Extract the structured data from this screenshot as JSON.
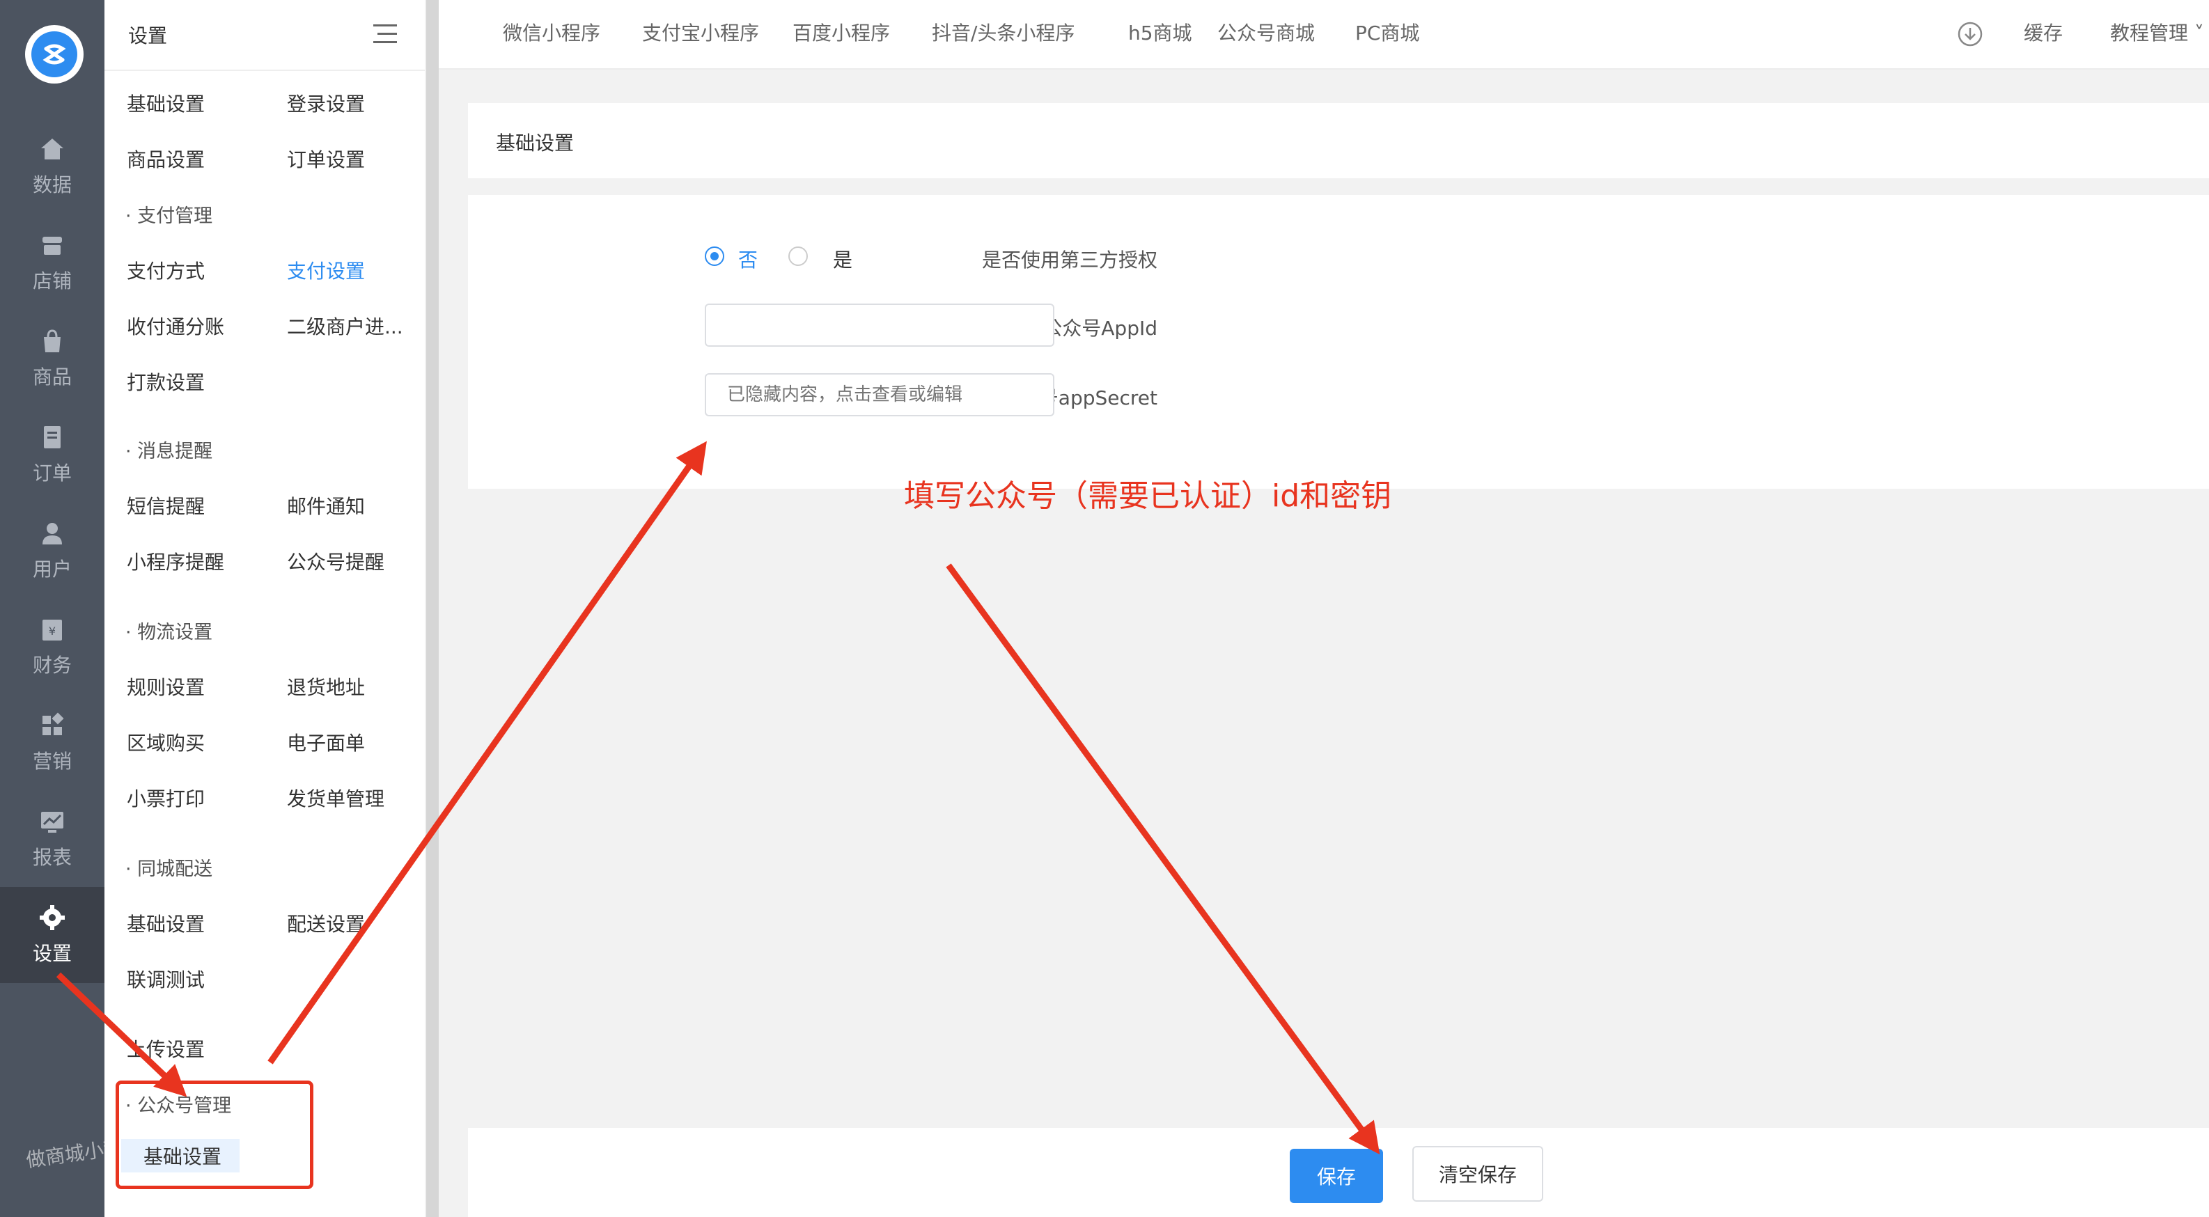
{
  "rail": {
    "items": [
      {
        "label": "数据",
        "icon": "home-icon"
      },
      {
        "label": "店铺",
        "icon": "store-icon"
      },
      {
        "label": "商品",
        "icon": "bag-icon"
      },
      {
        "label": "订单",
        "icon": "order-icon"
      },
      {
        "label": "用户",
        "icon": "user-icon"
      },
      {
        "label": "财务",
        "icon": "finance-icon"
      },
      {
        "label": "营销",
        "icon": "marketing-icon"
      },
      {
        "label": "报表",
        "icon": "report-icon"
      },
      {
        "label": "设置",
        "icon": "gear-icon"
      }
    ],
    "active": "设置"
  },
  "submenu": {
    "title": "设置",
    "basic": [
      "基础设置",
      "登录设置",
      "商品设置",
      "订单设置"
    ],
    "pay_group": "支付管理",
    "pay": [
      "支付方式",
      "支付设置",
      "收付通分账",
      "二级商户进...",
      "打款设置"
    ],
    "msg_group": "消息提醒",
    "msg": [
      "短信提醒",
      "邮件通知",
      "小程序提醒",
      "公众号提醒"
    ],
    "logistics_group": "物流设置",
    "logistics": [
      "规则设置",
      "退货地址",
      "区域购买",
      "电子面单",
      "小票打印",
      "发货单管理"
    ],
    "city_group": "同城配送",
    "city": [
      "基础设置",
      "配送设置",
      "联调测试"
    ],
    "upload": "上传设置",
    "mp_group": "公众号管理",
    "mp_current": "基础设置"
  },
  "topnav": {
    "tabs": [
      "微信小程序",
      "支付宝小程序",
      "百度小程序",
      "抖音/头条小程序",
      "h5商城",
      "公众号商城",
      "PC商城"
    ],
    "cache": "缓存",
    "tutorial": "教程管理"
  },
  "card": {
    "title": "基础设置"
  },
  "form": {
    "third_party_label": "是否使用第三方授权",
    "option_no": "否",
    "option_yes": "是",
    "selected": "否",
    "appid_label": "公众号AppId",
    "appid_value": "",
    "secret_label": "公众号appSecret",
    "secret_placeholder": "已隐藏内容，点击查看或编辑"
  },
  "footer": {
    "save": "保存",
    "clear_save": "清空保存"
  },
  "annotation": {
    "text": "填写公众号（需要已认证）id和密钥",
    "color": "#e8341f"
  },
  "watermark": "做商城小程序找傲科云鹏",
  "colors": {
    "primary": "#2d8cf0",
    "rail_bg": "#4c5460",
    "annotation": "#e8341f"
  }
}
